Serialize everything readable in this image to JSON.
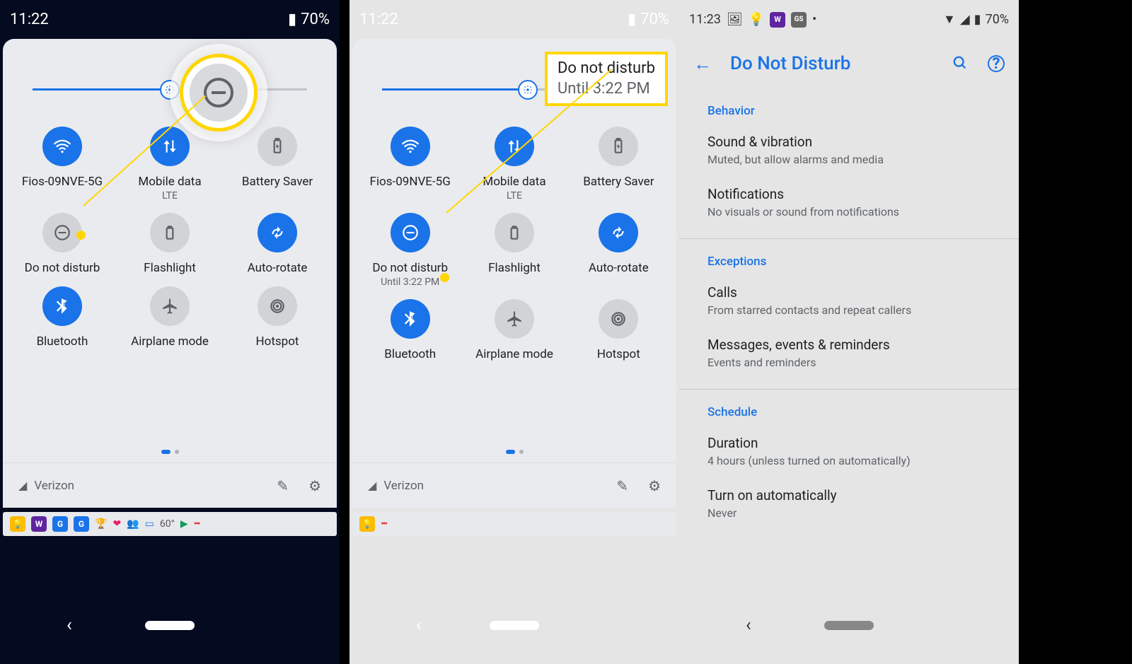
{
  "phone1": {
    "time": "11:22",
    "battery": "70%",
    "brightness_pct": 50,
    "tiles": [
      {
        "label": "Fios-09NVE-5G",
        "sub": "",
        "on": true,
        "icon": "wifi"
      },
      {
        "label": "Mobile data",
        "sub": "LTE",
        "on": true,
        "icon": "data"
      },
      {
        "label": "Battery Saver",
        "sub": "",
        "on": false,
        "icon": "battery"
      },
      {
        "label": "Do not disturb",
        "sub": "",
        "on": false,
        "icon": "dnd"
      },
      {
        "label": "Flashlight",
        "sub": "",
        "on": false,
        "icon": "flash"
      },
      {
        "label": "Auto-rotate",
        "sub": "",
        "on": true,
        "icon": "rotate"
      },
      {
        "label": "Bluetooth",
        "sub": "",
        "on": true,
        "icon": "bt"
      },
      {
        "label": "Airplane mode",
        "sub": "",
        "on": false,
        "icon": "plane"
      },
      {
        "label": "Hotspot",
        "sub": "",
        "on": false,
        "icon": "hotspot"
      }
    ],
    "carrier": "Verizon",
    "noti_temp": "60°"
  },
  "phone2": {
    "time": "11:22",
    "battery": "70%",
    "brightness_pct": 55,
    "highlight_title": "Do not disturb",
    "highlight_sub": "Until 3:22 PM",
    "tiles": [
      {
        "label": "Fios-09NVE-5G",
        "sub": "",
        "on": true,
        "icon": "wifi"
      },
      {
        "label": "Mobile data",
        "sub": "LTE",
        "on": true,
        "icon": "data"
      },
      {
        "label": "Battery Saver",
        "sub": "",
        "on": false,
        "icon": "battery"
      },
      {
        "label": "Do not disturb",
        "sub": "Until 3:22 PM",
        "on": true,
        "icon": "dnd"
      },
      {
        "label": "Flashlight",
        "sub": "",
        "on": false,
        "icon": "flash"
      },
      {
        "label": "Auto-rotate",
        "sub": "",
        "on": true,
        "icon": "rotate"
      },
      {
        "label": "Bluetooth",
        "sub": "",
        "on": true,
        "icon": "bt"
      },
      {
        "label": "Airplane mode",
        "sub": "",
        "on": false,
        "icon": "plane"
      },
      {
        "label": "Hotspot",
        "sub": "",
        "on": false,
        "icon": "hotspot"
      }
    ],
    "carrier": "Verizon"
  },
  "phone3": {
    "time": "11:23",
    "battery": "70%",
    "title": "Do Not Disturb",
    "sections": [
      {
        "heading": "Behavior",
        "items": [
          {
            "title": "Sound & vibration",
            "sub": "Muted, but allow alarms and media"
          },
          {
            "title": "Notifications",
            "sub": "No visuals or sound from notifications"
          }
        ]
      },
      {
        "heading": "Exceptions",
        "items": [
          {
            "title": "Calls",
            "sub": "From starred contacts and repeat callers"
          },
          {
            "title": "Messages, events & reminders",
            "sub": "Events and reminders"
          }
        ]
      },
      {
        "heading": "Schedule",
        "items": [
          {
            "title": "Duration",
            "sub": "4 hours (unless turned on automatically)"
          },
          {
            "title": "Turn on automatically",
            "sub": "Never"
          }
        ]
      }
    ]
  },
  "icons": {
    "wifi": "wifi",
    "data": "↕",
    "battery": "⚡",
    "dnd": "⊖",
    "flash": "▮",
    "rotate": "⟳",
    "bt": "ᛒ",
    "plane": "✈",
    "hotspot": "◎",
    "pencil": "✎",
    "gear": "⚙",
    "signal": "◢",
    "search": "🔍",
    "help": "?",
    "back": "←",
    "photo": "🖼",
    "bulb": "💡",
    "w": "W",
    "gs": "GS"
  }
}
